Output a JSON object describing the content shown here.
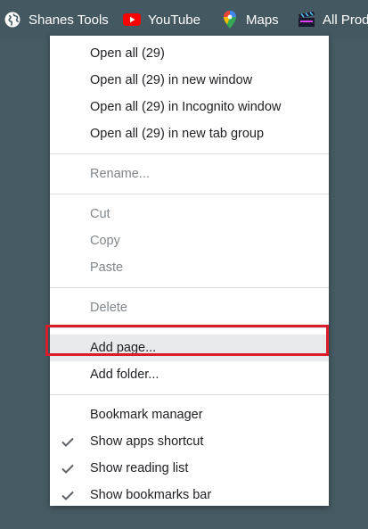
{
  "bookmarks_bar": {
    "items": [
      {
        "label": "Shanes Tools",
        "icon": "globe-icon"
      },
      {
        "label": "YouTube",
        "icon": "youtube-icon"
      },
      {
        "label": "Maps",
        "icon": "maps-pin-icon"
      },
      {
        "label": "All Prod",
        "icon": "film-clapper-icon"
      }
    ]
  },
  "context_menu": {
    "open_all": "Open all (29)",
    "open_all_window": "Open all (29) in new window",
    "open_all_incognito": "Open all (29) in Incognito window",
    "open_all_tab_group": "Open all (29) in new tab group",
    "rename": "Rename...",
    "cut": "Cut",
    "copy": "Copy",
    "paste": "Paste",
    "delete": "Delete",
    "add_page": "Add page...",
    "add_folder": "Add folder...",
    "bookmark_manager": "Bookmark manager",
    "show_apps_shortcut": "Show apps shortcut",
    "show_reading_list": "Show reading list",
    "show_bookmarks_bar": "Show bookmarks bar"
  },
  "colors": {
    "background": "#455a62",
    "highlight_outline": "#d81e2a",
    "youtube_red": "#ff0000"
  }
}
